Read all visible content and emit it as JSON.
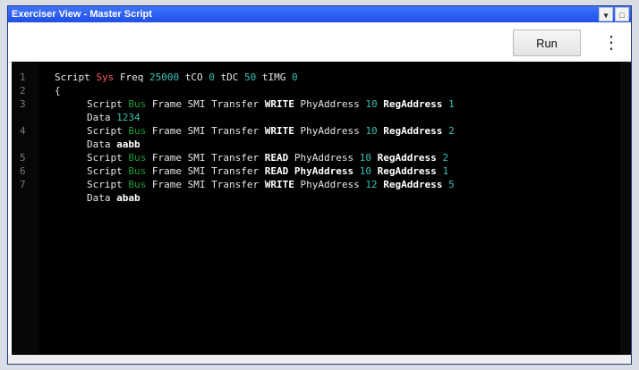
{
  "window": {
    "title": "Exerciser View - Master Script",
    "title_ctrl_1": "▾",
    "title_ctrl_2": "□"
  },
  "toolbar": {
    "run_label": "Run",
    "menu_glyph": "⋮"
  },
  "editor": {
    "lines": [
      {
        "no": "1",
        "segments": [
          {
            "text": "Script ",
            "class": "kw"
          },
          {
            "text": "Sys ",
            "class": "kw-red"
          },
          {
            "text": "Freq ",
            "class": "kw"
          },
          {
            "text": "25000 ",
            "class": "num"
          },
          {
            "text": "tCO ",
            "class": "kw"
          },
          {
            "text": "0 ",
            "class": "num"
          },
          {
            "text": "tDC ",
            "class": "kw"
          },
          {
            "text": "50 ",
            "class": "num"
          },
          {
            "text": "tIMG ",
            "class": "kw"
          },
          {
            "text": "0",
            "class": "num"
          }
        ]
      },
      {
        "no": "2",
        "segments": [
          {
            "text": "{",
            "class": "kw"
          }
        ]
      },
      {
        "no": "3",
        "lead": "lead-2",
        "segments": [
          {
            "text": "Script ",
            "class": "kw"
          },
          {
            "text": "Bus ",
            "class": "kw-green"
          },
          {
            "text": "Frame ",
            "class": "kw"
          },
          {
            "text": "SMI ",
            "class": "kw"
          },
          {
            "text": "Transfer ",
            "class": "kw"
          },
          {
            "text": "WRITE ",
            "class": "strong"
          },
          {
            "text": "PhyAddress ",
            "class": "kw"
          },
          {
            "text": "10 ",
            "class": "num"
          },
          {
            "text": "RegAddress ",
            "class": "strong"
          },
          {
            "text": "1",
            "class": "num"
          }
        ]
      },
      {
        "no": "",
        "lead": "lead-2",
        "segments": [
          {
            "text": "Data ",
            "class": "kw"
          },
          {
            "text": "1234",
            "class": "num"
          }
        ]
      },
      {
        "no": "4",
        "lead": "lead-2",
        "segments": [
          {
            "text": "Script ",
            "class": "kw"
          },
          {
            "text": "Bus ",
            "class": "kw-green"
          },
          {
            "text": "Frame ",
            "class": "kw"
          },
          {
            "text": "SMI ",
            "class": "kw"
          },
          {
            "text": "Transfer ",
            "class": "kw"
          },
          {
            "text": "WRITE ",
            "class": "strong"
          },
          {
            "text": "PhyAddress ",
            "class": "kw"
          },
          {
            "text": "10 ",
            "class": "num"
          },
          {
            "text": "RegAddress ",
            "class": "strong"
          },
          {
            "text": "2",
            "class": "num"
          }
        ]
      },
      {
        "no": "",
        "lead": "lead-2",
        "segments": [
          {
            "text": "Data ",
            "class": "kw"
          },
          {
            "text": "aabb",
            "class": "strong"
          }
        ]
      },
      {
        "no": "5",
        "lead": "lead-2",
        "segments": [
          {
            "text": "Script ",
            "class": "kw"
          },
          {
            "text": "Bus ",
            "class": "kw-green"
          },
          {
            "text": "Frame ",
            "class": "kw"
          },
          {
            "text": "SMI ",
            "class": "kw"
          },
          {
            "text": "Transfer ",
            "class": "kw"
          },
          {
            "text": "READ ",
            "class": "strong"
          },
          {
            "text": "PhyAddress ",
            "class": "kw"
          },
          {
            "text": "10 ",
            "class": "num"
          },
          {
            "text": "RegAddress ",
            "class": "strong"
          },
          {
            "text": "2",
            "class": "num"
          }
        ]
      },
      {
        "no": "6",
        "lead": "lead-2",
        "segments": [
          {
            "text": "Script ",
            "class": "kw"
          },
          {
            "text": "Bus ",
            "class": "kw-green"
          },
          {
            "text": "Frame ",
            "class": "kw"
          },
          {
            "text": "SMI ",
            "class": "kw"
          },
          {
            "text": "Transfer ",
            "class": "kw"
          },
          {
            "text": "READ ",
            "class": "strong"
          },
          {
            "text": "PhyAddress ",
            "class": "strong"
          },
          {
            "text": "10 ",
            "class": "num"
          },
          {
            "text": "RegAddress ",
            "class": "strong"
          },
          {
            "text": "1",
            "class": "num"
          }
        ]
      },
      {
        "no": "7",
        "lead": "lead-2",
        "segments": [
          {
            "text": "Script ",
            "class": "kw"
          },
          {
            "text": "Bus ",
            "class": "kw-green"
          },
          {
            "text": "Frame ",
            "class": "kw"
          },
          {
            "text": "SMI ",
            "class": "kw"
          },
          {
            "text": "Transfer ",
            "class": "kw"
          },
          {
            "text": "WRITE ",
            "class": "strong"
          },
          {
            "text": "PhyAddress ",
            "class": "kw"
          },
          {
            "text": "12 ",
            "class": "num"
          },
          {
            "text": "RegAddress ",
            "class": "strong"
          },
          {
            "text": "5",
            "class": "num"
          }
        ]
      },
      {
        "no": "",
        "lead": "lead-2",
        "segments": [
          {
            "text": "Data ",
            "class": "kw"
          },
          {
            "text": "abab",
            "class": "strong"
          }
        ]
      }
    ]
  },
  "colors": {
    "title_bar": "#1f4fe6",
    "editor_bg": "#000000",
    "keyword_red": "#ff5a5a",
    "keyword_green": "#1f9e3a",
    "number_cyan": "#38c1b6"
  }
}
